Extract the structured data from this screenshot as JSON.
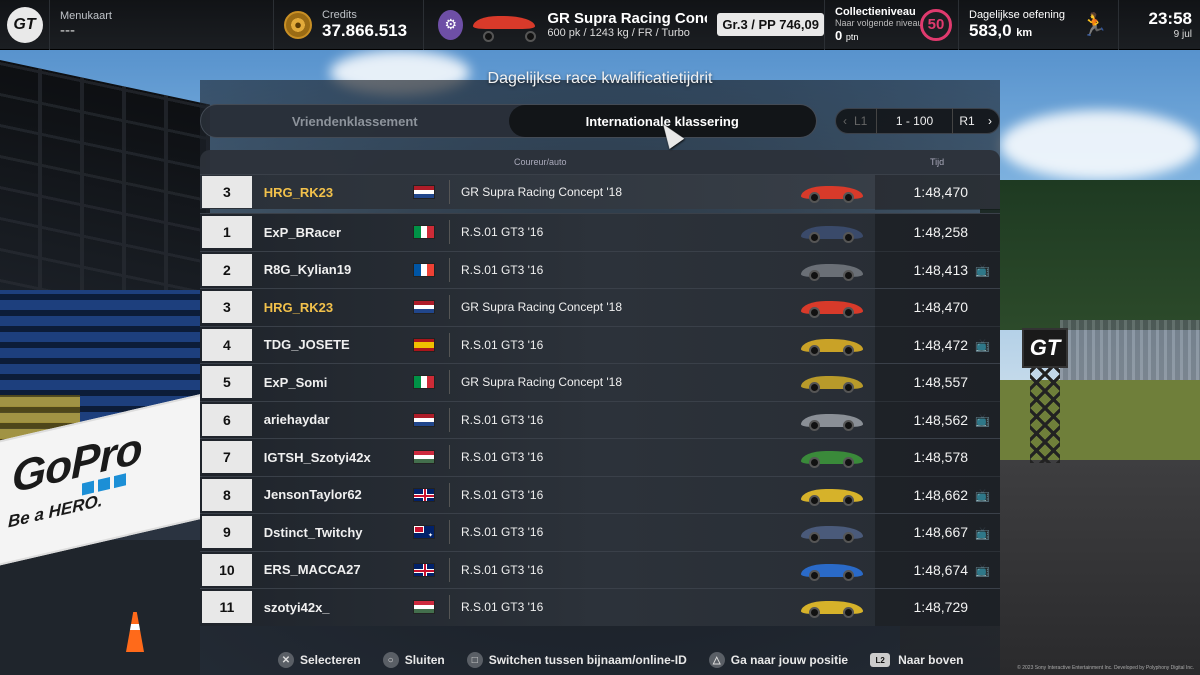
{
  "topbar": {
    "logo": "GT",
    "menu_label": "Menukaart",
    "menu_value": "---",
    "credits_label": "Credits",
    "credits_value": "37.866.513",
    "car_name": "GR Supra Racing Conc…",
    "car_specs": "600 pk / 1243 kg / FR / Turbo",
    "car_class": "Gr.3 / PP 746,09",
    "collection_label": "Collectieniveau",
    "collection_sub": "Naar volgende niveau",
    "collection_value": "0",
    "collection_unit": "ptn",
    "level": "50",
    "daily_label": "Dagelijkse oefening",
    "daily_value": "583,0",
    "daily_unit": "km",
    "time": "23:58",
    "date": "9 jul"
  },
  "page_title": "Dagelijkse race kwalificatietijdrit",
  "tabs": [
    {
      "label": "Vriendenklassement",
      "active": false
    },
    {
      "label": "Internationale klassering",
      "active": true
    }
  ],
  "pager": {
    "left": "L1",
    "range": "1 - 100",
    "right": "R1"
  },
  "table_headers": {
    "driver": "Coureur/auto",
    "time": "Tijd"
  },
  "my_entry": {
    "rank": "3",
    "name": "HRG_RK23",
    "flag": "nl",
    "car": "GR Supra Racing Concept '18",
    "car_color": "#d83a2a",
    "time": "1:48,470",
    "tv": false
  },
  "rows": [
    {
      "rank": "1",
      "name": "ExP_BRacer",
      "flag": "it",
      "car": "R.S.01 GT3 '16",
      "car_color": "#3a4a6a",
      "time": "1:48,258",
      "tv": false
    },
    {
      "rank": "2",
      "name": "R8G_Kylian19",
      "flag": "fr",
      "car": "R.S.01 GT3 '16",
      "car_color": "#6a6f76",
      "time": "1:48,413",
      "tv": true
    },
    {
      "rank": "3",
      "name": "HRG_RK23",
      "flag": "nl",
      "car": "GR Supra Racing Concept '18",
      "car_color": "#d83a2a",
      "time": "1:48,470",
      "tv": false
    },
    {
      "rank": "4",
      "name": "TDG_JOSETE",
      "flag": "es",
      "car": "R.S.01 GT3 '16",
      "car_color": "#c9a227",
      "time": "1:48,472",
      "tv": true
    },
    {
      "rank": "5",
      "name": "ExP_Somi",
      "flag": "it",
      "car": "GR Supra Racing Concept '18",
      "car_color": "#b89a2a",
      "time": "1:48,557",
      "tv": false
    },
    {
      "rank": "6",
      "name": "ariehaydar",
      "flag": "nl",
      "car": "R.S.01 GT3 '16",
      "car_color": "#8a8f96",
      "time": "1:48,562",
      "tv": true
    },
    {
      "rank": "7",
      "name": "IGTSH_Szotyi42x",
      "flag": "hu",
      "car": "R.S.01 GT3 '16",
      "car_color": "#3a8a3a",
      "time": "1:48,578",
      "tv": false
    },
    {
      "rank": "8",
      "name": "JensonTaylor62",
      "flag": "uk",
      "car": "R.S.01 GT3 '16",
      "car_color": "#d6b22a",
      "time": "1:48,662",
      "tv": true
    },
    {
      "rank": "9",
      "name": "Dstinct_Twitchy",
      "flag": "au",
      "car": "R.S.01 GT3 '16",
      "car_color": "#4a5a7a",
      "time": "1:48,667",
      "tv": true
    },
    {
      "rank": "10",
      "name": "ERS_MACCA27",
      "flag": "uk",
      "car": "R.S.01 GT3 '16",
      "car_color": "#2a6ac8",
      "time": "1:48,674",
      "tv": true
    },
    {
      "rank": "11",
      "name": "szotyi42x_",
      "flag": "hu",
      "car": "R.S.01 GT3 '16",
      "car_color": "#d6b22a",
      "time": "1:48,729",
      "tv": false
    }
  ],
  "footer": [
    {
      "icon": "✕",
      "label": "Selecteren"
    },
    {
      "icon": "○",
      "label": "Sluiten"
    },
    {
      "icon": "□",
      "label": "Switchen tussen bijnaam/online-ID"
    },
    {
      "icon": "△",
      "label": "Ga naar jouw positie"
    },
    {
      "icon": "L2",
      "label": "Naar boven"
    }
  ],
  "billboard": {
    "brand": "GoPro",
    "tagline": "Be a HERO."
  },
  "copyright": "© 2023 Sony Interactive Entertainment Inc. Developed by Polyphony Digital Inc."
}
